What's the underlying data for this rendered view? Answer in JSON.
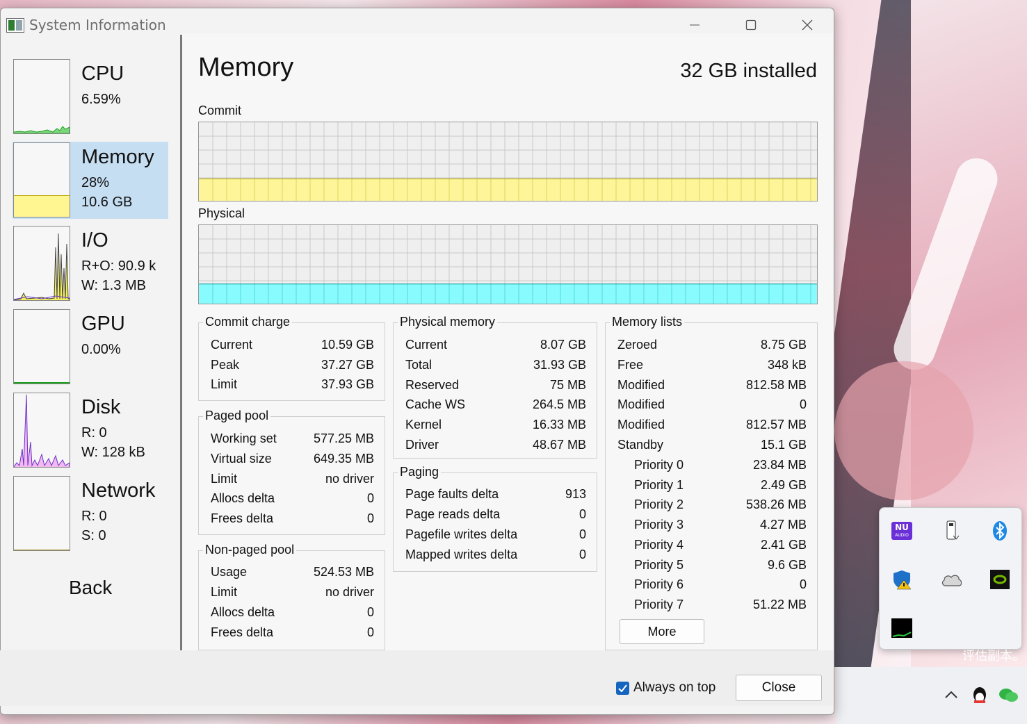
{
  "window": {
    "title": "System Information"
  },
  "sidebar": {
    "items": [
      {
        "name": "CPU",
        "line1": "6.59%",
        "line2": ""
      },
      {
        "name": "Memory",
        "line1": "28%",
        "line2": "10.6 GB"
      },
      {
        "name": "I/O",
        "line1": "R+O: 90.9 k",
        "line2": "W: 1.3 MB"
      },
      {
        "name": "GPU",
        "line1": "0.00%",
        "line2": ""
      },
      {
        "name": "Disk",
        "line1": "R: 0",
        "line2": "W: 128 kB"
      },
      {
        "name": "Network",
        "line1": "R: 0",
        "line2": "S: 0"
      }
    ],
    "back_label": "Back",
    "selected": "Memory"
  },
  "main": {
    "title": "Memory",
    "installed": "32 GB installed",
    "commit_graph_label": "Commit",
    "physical_graph_label": "Physical",
    "commit_fill_fraction": 0.28,
    "physical_fill_fraction": 0.25,
    "colors": {
      "commit_fill": "#fff591",
      "physical_fill": "#7ffcff",
      "selected": "#c5def2",
      "accent": "#1565c0"
    }
  },
  "commit_charge": {
    "title": "Commit charge",
    "rows": [
      [
        "Current",
        "10.59 GB"
      ],
      [
        "Peak",
        "37.27 GB"
      ],
      [
        "Limit",
        "37.93 GB"
      ]
    ]
  },
  "paged_pool": {
    "title": "Paged pool",
    "rows": [
      [
        "Working set",
        "577.25 MB"
      ],
      [
        "Virtual size",
        "649.35 MB"
      ],
      [
        "Limit",
        "no driver"
      ],
      [
        "Allocs delta",
        "0"
      ],
      [
        "Frees delta",
        "0"
      ]
    ]
  },
  "nonpaged_pool": {
    "title": "Non-paged pool",
    "rows": [
      [
        "Usage",
        "524.53 MB"
      ],
      [
        "Limit",
        "no driver"
      ],
      [
        "Allocs delta",
        "0"
      ],
      [
        "Frees delta",
        "0"
      ]
    ]
  },
  "physical_memory": {
    "title": "Physical memory",
    "rows": [
      [
        "Current",
        "8.07 GB"
      ],
      [
        "Total",
        "31.93 GB"
      ],
      [
        "Reserved",
        "75 MB"
      ],
      [
        "Cache WS",
        "264.5 MB"
      ],
      [
        "Kernel",
        "16.33 MB"
      ],
      [
        "Driver",
        "48.67 MB"
      ]
    ]
  },
  "paging": {
    "title": "Paging",
    "rows": [
      [
        "Page faults delta",
        "913"
      ],
      [
        "Page reads delta",
        "0"
      ],
      [
        "Pagefile writes delta",
        "0"
      ],
      [
        "Mapped writes delta",
        "0"
      ]
    ]
  },
  "memory_lists": {
    "title": "Memory lists",
    "rows": [
      [
        "Zeroed",
        "8.75 GB"
      ],
      [
        "Free",
        "348 kB"
      ],
      [
        "Modified",
        "812.58 MB"
      ],
      [
        "Modified",
        "0"
      ],
      [
        "Modified",
        "812.57 MB"
      ],
      [
        "Standby",
        "15.1 GB"
      ]
    ],
    "priority_rows": [
      [
        "Priority 0",
        "23.84 MB"
      ],
      [
        "Priority 1",
        "2.49 GB"
      ],
      [
        "Priority 2",
        "538.26 MB"
      ],
      [
        "Priority 3",
        "4.27 MB"
      ],
      [
        "Priority 4",
        "2.41 GB"
      ],
      [
        "Priority 5",
        "9.6 GB"
      ],
      [
        "Priority 6",
        "0"
      ],
      [
        "Priority 7",
        "51.22 MB"
      ]
    ],
    "more_label": "More"
  },
  "footer": {
    "always_on_top_label": "Always on top",
    "always_on_top_checked": true,
    "close_label": "Close"
  },
  "tray": {
    "icons": [
      "nu-audio-icon",
      "usb-drive-icon",
      "bluetooth-icon",
      "windows-security-warning-icon",
      "onedrive-cloud-icon",
      "nvidia-icon",
      "system-informer-icon"
    ],
    "nu_text": "NU",
    "nu_sub": "AUDIO"
  },
  "watermark": "评估副本。"
}
